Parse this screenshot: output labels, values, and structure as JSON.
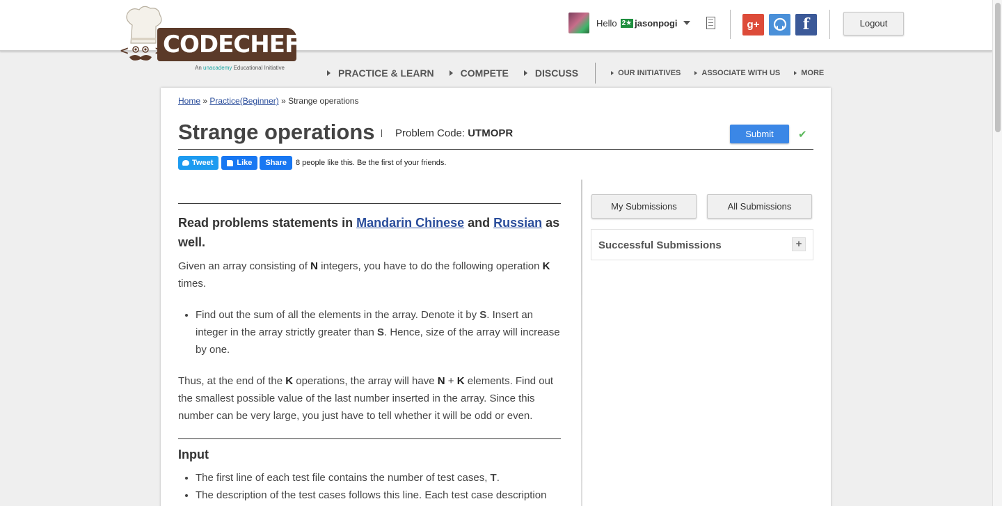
{
  "header": {
    "logo_text": "CODECHEF",
    "tagline_prefix": "An ",
    "tagline_brand": "unacademy",
    "tagline_suffix": " Educational Initiative",
    "greeting": "Hello",
    "star_badge": "2★",
    "username": "jasonpogi",
    "logout_label": "Logout"
  },
  "nav": {
    "main": [
      "PRACTICE & LEARN",
      "COMPETE",
      "DISCUSS"
    ],
    "secondary": [
      "OUR INITIATIVES",
      "ASSOCIATE WITH US",
      "MORE"
    ]
  },
  "breadcrumb": {
    "home": "Home",
    "sep1": " » ",
    "practice": "Practice(Beginner)",
    "sep2": " » ",
    "current": "Strange operations"
  },
  "problem": {
    "title": "Strange operations",
    "code_label": "Problem Code: ",
    "code": "UTMOPR",
    "submit_label": "Submit"
  },
  "share": {
    "tweet": "Tweet",
    "like": "Like",
    "share": "Share",
    "like_text": "8 people like this. Be the first of your friends."
  },
  "statement": {
    "read_prefix": "Read problems statements in ",
    "lang1": "Mandarin Chinese",
    "read_and": " and ",
    "lang2": "Russian",
    "read_suffix": " as well."
  },
  "submissions": {
    "my": "My Submissions",
    "all": "All Submissions",
    "successful": "Successful Submissions"
  },
  "input_heading": "Input"
}
